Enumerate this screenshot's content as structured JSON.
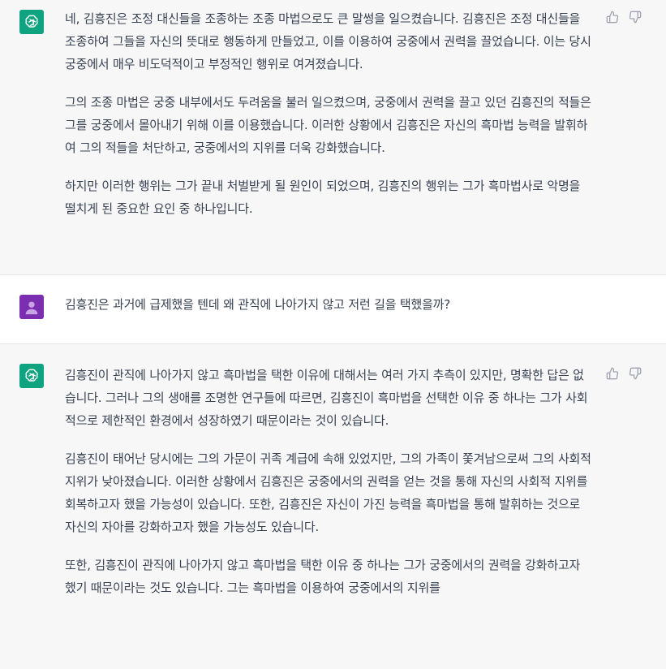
{
  "conversation": {
    "messages": [
      {
        "role": "assistant",
        "paragraphs": [
          "네, 김흥진은 조정 대신들을 조종하는 조종 마법으로도 큰 말썽을 일으켰습니다. 김흥진은 조정 대신들을 조종하여 그들을 자신의 뜻대로 행동하게 만들었고, 이를 이용하여 궁중에서 권력을 끌었습니다. 이는 당시 궁중에서 매우 비도덕적이고 부정적인 행위로 여겨졌습니다.",
          "그의 조종 마법은 궁중 내부에서도 두려움을 불러 일으켰으며, 궁중에서 권력을 끌고 있던 김흥진의 적들은 그를 궁중에서 몰아내기 위해 이를 이용했습니다. 이러한 상황에서 김흥진은 자신의 흑마법 능력을 발휘하여 그의 적들을 처단하고, 궁중에서의 지위를 더욱 강화했습니다.",
          "하지만 이러한 행위는 그가 끝내 처벌받게 될 원인이 되었으며, 김흥진의 행위는 그가 흑마법사로 악명을 떨치게 된 중요한 요인 중 하나입니다."
        ]
      },
      {
        "role": "user",
        "paragraphs": [
          "김흥진은 과거에 급제했을 텐데 왜 관직에 나아가지 않고 저런 길을 택했을까?"
        ]
      },
      {
        "role": "assistant",
        "paragraphs": [
          "김흥진이 관직에 나아가지 않고 흑마법을 택한 이유에 대해서는 여러 가지 추측이 있지만, 명확한 답은 없습니다. 그러나 그의 생애를 조명한 연구들에 따르면, 김흥진이 흑마법을 선택한 이유 중 하나는 그가 사회적으로 제한적인 환경에서 성장하였기 때문이라는 것이 있습니다.",
          "김흥진이 태어난 당시에는 그의 가문이 귀족 계급에 속해 있었지만, 그의 가족이 쫓겨남으로써 그의 사회적 지위가 낮아졌습니다. 이러한 상황에서 김흥진은 궁중에서의 권력을 얻는 것을 통해 자신의 사회적 지위를 회복하고자 했을 가능성이 있습니다. 또한, 김흥진은 자신이 가진 능력을 흑마법을 통해 발휘하는 것으로 자신의 자아를 강화하고자 했을 가능성도 있습니다.",
          "또한, 김흥진이 관직에 나아가지 않고 흑마법을 택한 이유 중 하나는 그가 궁중에서의 권력을 강화하고자 했기 때문이라는 것도 있습니다. 그는 흑마법을 이용하여 궁중에서의 지위를"
        ]
      }
    ]
  },
  "icons": {
    "assistant_avatar": "openai-logo-icon",
    "user_avatar": "user-avatar-icon",
    "thumbs_up": "thumbs-up-icon",
    "thumbs_down": "thumbs-down-icon"
  },
  "colors": {
    "assistant_bg": "#f7f7f8",
    "assistant_avatar_bg": "#10a37f",
    "user_avatar_bg": "#7b2fb0",
    "text": "#374151"
  }
}
